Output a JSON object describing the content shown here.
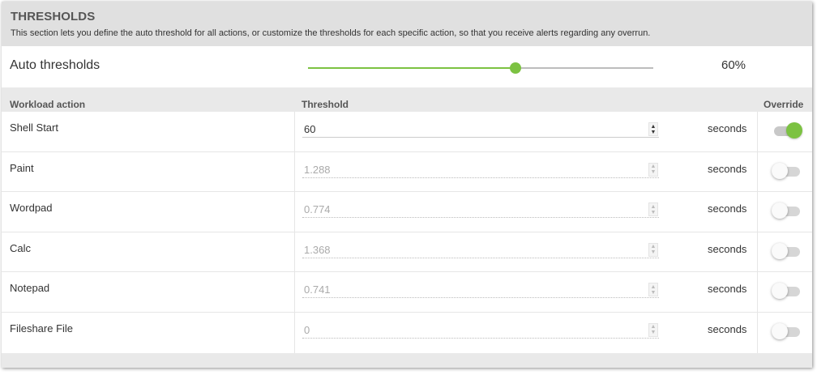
{
  "section": {
    "title": "THRESHOLDS",
    "description": "This section lets you define the auto threshold for all actions, or customize the thresholds for each specific action, so that you receive alerts regarding any overrun."
  },
  "auto_thresholds": {
    "label": "Auto thresholds",
    "value_text": "60%",
    "slider_percent": 60,
    "accent_color": "#7cc242"
  },
  "columns": {
    "action": "Workload action",
    "threshold": "Threshold",
    "override": "Override"
  },
  "rows": [
    {
      "action": "Shell Start",
      "threshold": "60",
      "unit": "seconds",
      "override": true
    },
    {
      "action": "Paint",
      "threshold": "1.288",
      "unit": "seconds",
      "override": false
    },
    {
      "action": "Wordpad",
      "threshold": "0.774",
      "unit": "seconds",
      "override": false
    },
    {
      "action": "Calc",
      "threshold": "1.368",
      "unit": "seconds",
      "override": false
    },
    {
      "action": "Notepad",
      "threshold": "0.741",
      "unit": "seconds",
      "override": false
    },
    {
      "action": "Fileshare File",
      "threshold": "0",
      "unit": "seconds",
      "override": false
    }
  ],
  "icons": {
    "spinner_up": "▲",
    "spinner_down": "▼"
  }
}
